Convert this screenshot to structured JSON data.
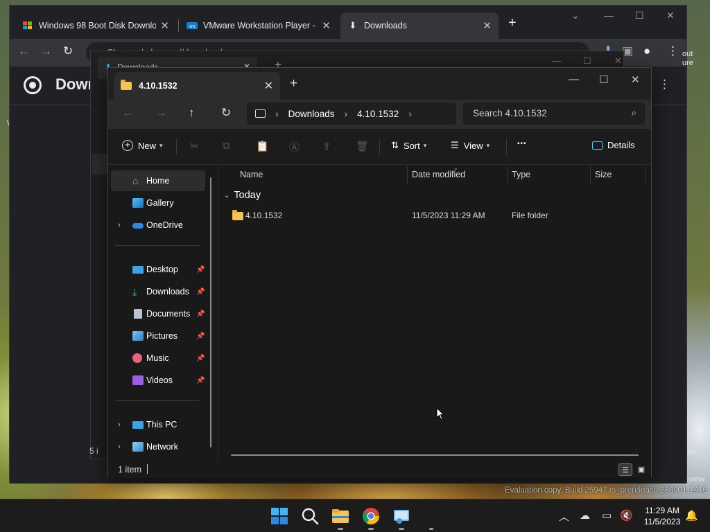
{
  "chrome": {
    "tabs": [
      {
        "title": "Windows 98 Boot Disk Downloa"
      },
      {
        "title": "VMware Workstation Player - V"
      },
      {
        "title": "Downloads"
      }
    ],
    "omnibox_text": "Chrome  |  chrome://downloads",
    "page_title": "Downl",
    "right_edge_text_1": "out",
    "right_edge_text_2": "ure"
  },
  "bg_window": {
    "tab_title": "Downloads"
  },
  "explorer": {
    "tab_title": "4.10.1532",
    "breadcrumb": [
      "Downloads",
      "4.10.1532"
    ],
    "search_placeholder": "Search 4.10.1532",
    "commands": {
      "new": "New",
      "sort": "Sort",
      "view": "View",
      "more": "•••",
      "details": "Details"
    },
    "sidebar": [
      {
        "label": "Home",
        "icon": "home-icon"
      },
      {
        "label": "Gallery",
        "icon": "gallery-icon"
      },
      {
        "label": "OneDrive",
        "icon": "onedrive-icon"
      },
      {
        "label": "Desktop",
        "icon": "desktop-icon"
      },
      {
        "label": "Downloads",
        "icon": "downloads-icon"
      },
      {
        "label": "Documents",
        "icon": "documents-icon"
      },
      {
        "label": "Pictures",
        "icon": "pictures-icon"
      },
      {
        "label": "Music",
        "icon": "music-icon"
      },
      {
        "label": "Videos",
        "icon": "videos-icon"
      },
      {
        "label": "This PC",
        "icon": "this-pc-icon"
      },
      {
        "label": "Network",
        "icon": "network-icon"
      }
    ],
    "columns": [
      "Name",
      "Date modified",
      "Type",
      "Size"
    ],
    "group_label": "Today",
    "rows": [
      {
        "name": "4.10.1532",
        "date": "11/5/2023 11:29 AM",
        "type": "File folder",
        "size": ""
      }
    ],
    "status": "1 item"
  },
  "desktop": {
    "watermark": "Evaluation copy. Build 25947.rs_prerelease.230901-1416",
    "edge_text_bin": "Bin",
    "edge_text_review": "eview",
    "edge_text_w": "W"
  },
  "taskbar": {
    "time": "11:29 AM",
    "date": "11/5/2023"
  },
  "colors": {
    "accent": "#4cc2ff",
    "folder": "#f5c451",
    "explorer_bg": "#191919"
  }
}
